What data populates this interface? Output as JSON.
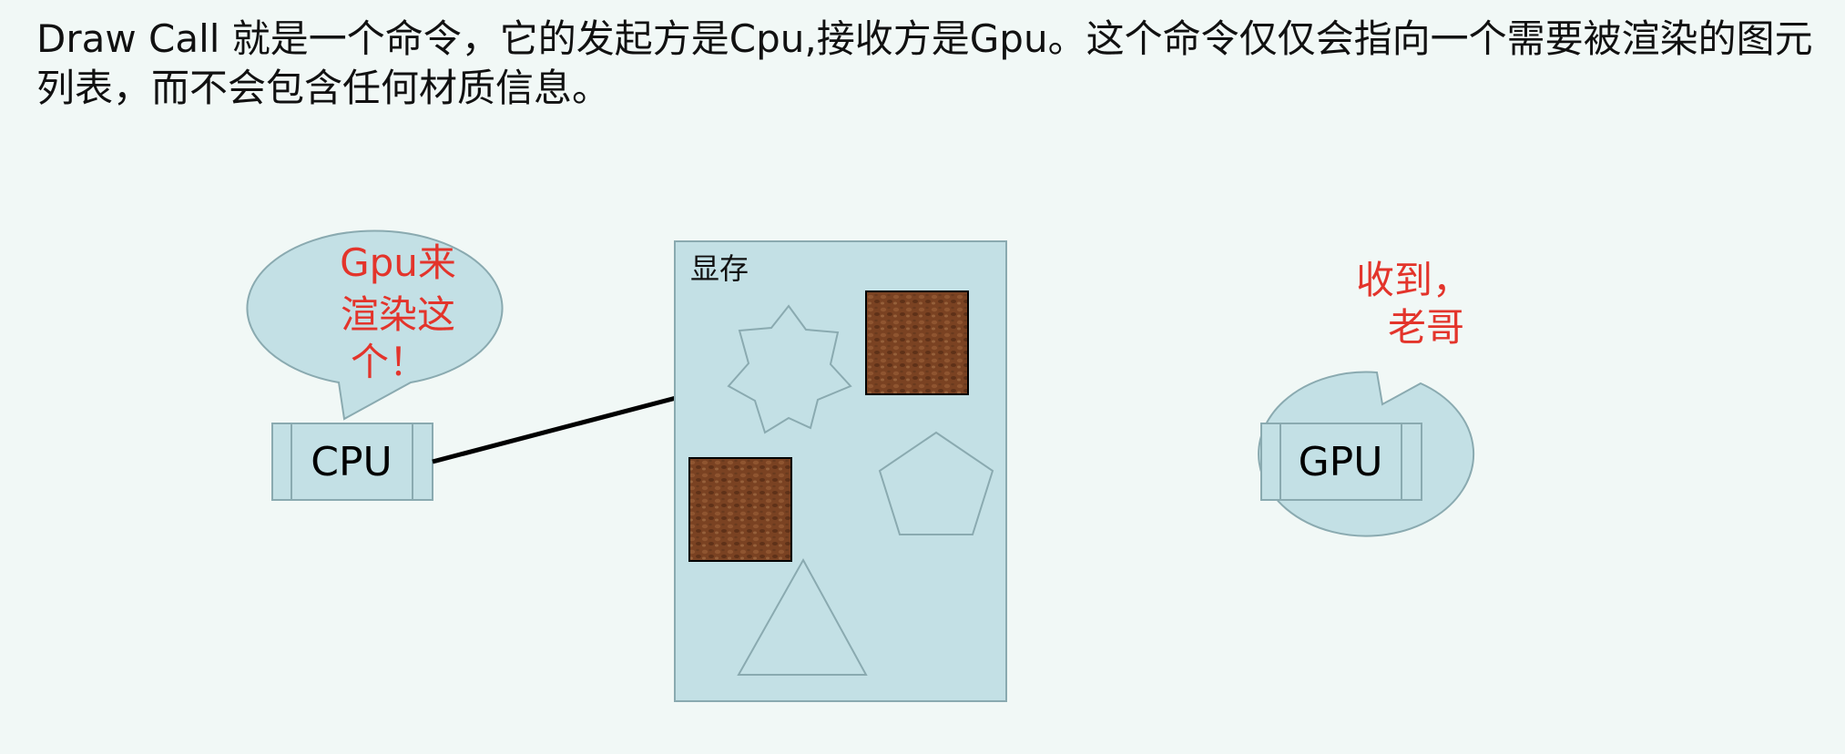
{
  "description": "Draw Call 就是一个命令，它的发起方是Cpu,接收方是Gpu。这个命令仅仅会指向一个需要被渲染的图元列表，而不会包含任何材质信息。",
  "cpu": {
    "label": "CPU",
    "speech_lines": [
      "Gpu来",
      "渲染这",
      "个！"
    ]
  },
  "memory": {
    "label": "显存"
  },
  "gpu": {
    "label": "GPU",
    "speech_lines": [
      "收到，",
      "老哥"
    ]
  },
  "colors": {
    "background": "#f1f8f6",
    "shape_fill": "#c3e0e5",
    "shape_stroke": "#8aaab0",
    "speech_text": "#e3342b",
    "texture": "#7a4222",
    "arrow": "#000000"
  },
  "icons": [
    "star-shape",
    "pentagon-shape",
    "triangle-shape",
    "texture-square"
  ]
}
